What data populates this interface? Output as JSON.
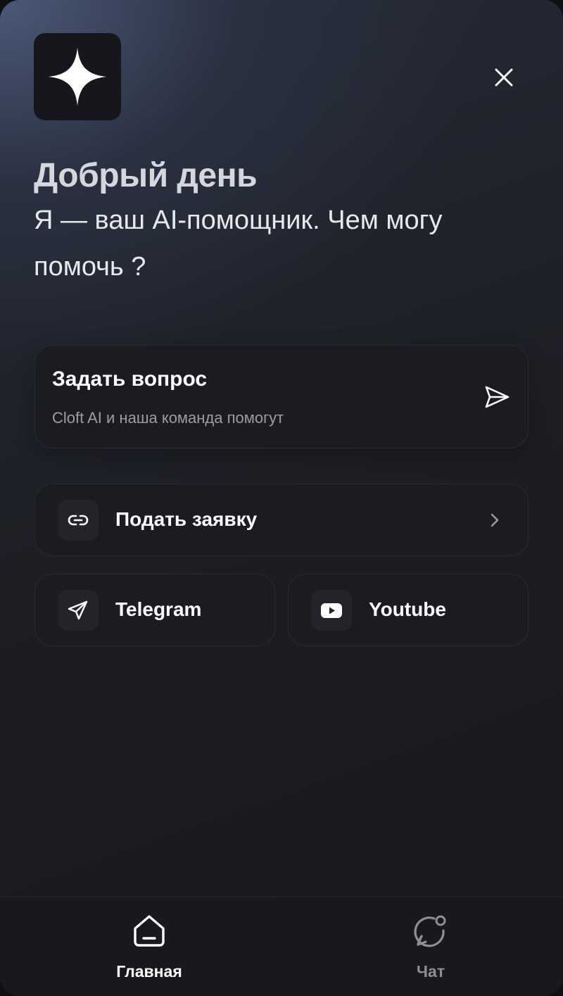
{
  "header": {
    "logo_icon": "sparkle-icon",
    "close_icon": "close-icon"
  },
  "greeting": {
    "title": "Добрый день",
    "subtitle": "Я — ваш AI-помощник. Чем могу помочь ?"
  },
  "ask_card": {
    "title": "Задать вопрос",
    "description": "Cloft AI и наша команда помогут",
    "icon": "send-icon"
  },
  "links": {
    "apply": {
      "label": "Подать заявку",
      "icon": "link-icon",
      "trailing_icon": "chevron-right-icon"
    },
    "telegram": {
      "label": "Telegram",
      "icon": "telegram-icon"
    },
    "youtube": {
      "label": "Youtube",
      "icon": "youtube-icon"
    }
  },
  "nav": {
    "home": {
      "label": "Главная",
      "icon": "home-icon",
      "active": true
    },
    "chat": {
      "label": "Чат",
      "icon": "chat-icon",
      "active": false
    }
  },
  "colors": {
    "background_top": "#4b5878",
    "background_bottom": "#18191c",
    "card": "#1b1c20",
    "text_primary": "#ffffff",
    "text_muted": "#9c9da5"
  }
}
